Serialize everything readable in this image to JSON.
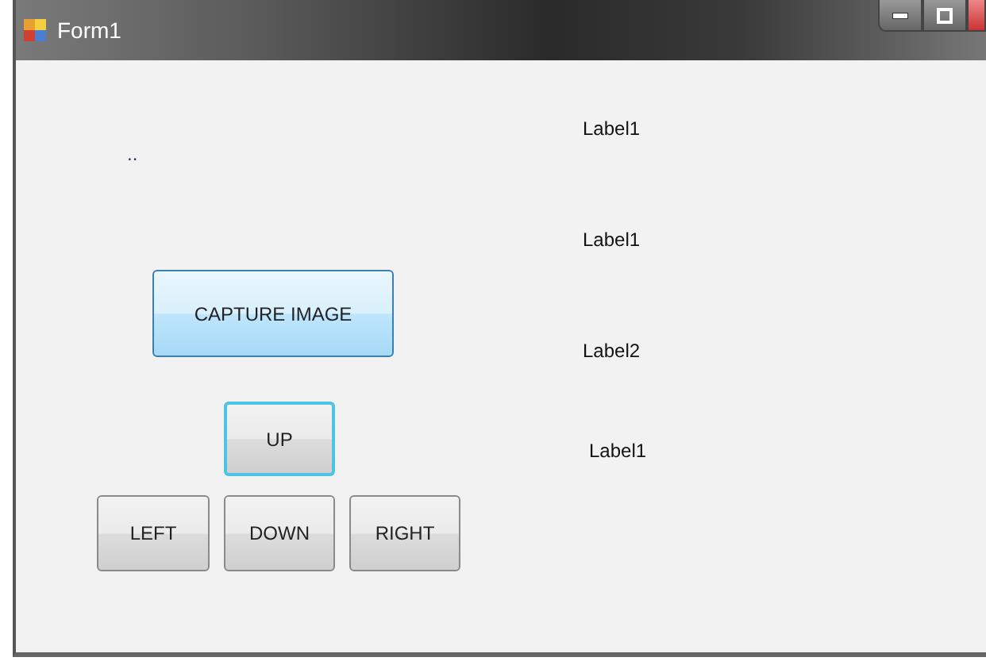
{
  "window": {
    "title": "Form1"
  },
  "dots_label": "..",
  "buttons": [
    {
      "label": "CAPTURE IMAGE",
      "hovered": true,
      "focused": false
    },
    {
      "label": "UP",
      "hovered": false,
      "focused": true
    },
    {
      "label": "LEFT",
      "hovered": false,
      "focused": false
    },
    {
      "label": "DOWN",
      "hovered": false,
      "focused": false
    },
    {
      "label": "RIGHT",
      "hovered": false,
      "focused": false
    }
  ],
  "labels": [
    "Label1",
    "Label1",
    "Label2",
    "Label1"
  ]
}
